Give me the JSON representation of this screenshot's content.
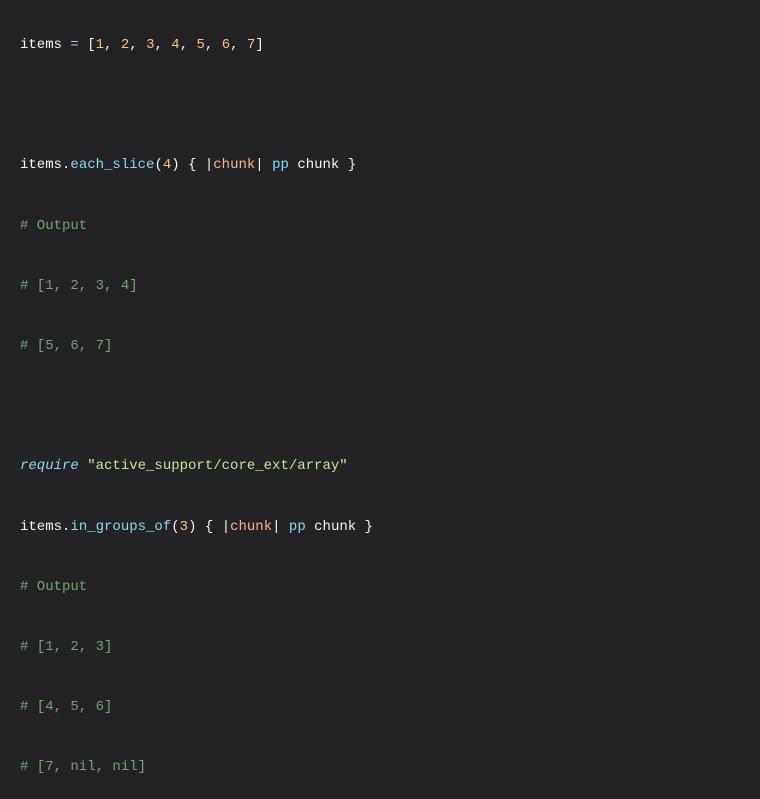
{
  "lines": {
    "l1": {
      "ident": "items",
      "op": "=",
      "open": "[",
      "n1": "1",
      "c1": ", ",
      "n2": "2",
      "c2": ", ",
      "n3": "3",
      "c3": ", ",
      "n4": "4",
      "c4": ", ",
      "n5": "5",
      "c5": ", ",
      "n6": "6",
      "c6": ", ",
      "n7": "7",
      "close": "]"
    },
    "l3": {
      "ident": "items",
      "dot1": ".",
      "method": "each_slice",
      "popen": "(",
      "arg": "4",
      "pclose": ")",
      "sp": " ",
      "bopen": "{ ",
      "pipe1": "|",
      "param": "chunk",
      "pipe2": "| ",
      "fn": "pp",
      "sp2": " ",
      "fnarg": "chunk",
      "bclose": " }"
    },
    "c_out1": "# Output",
    "c_arr1": "# [1, 2, 3, 4]",
    "c_arr2": "# [5, 6, 7]",
    "l8": {
      "keyword": "require",
      "sp": " ",
      "string": "\"active_support/core_ext/array\""
    },
    "l9": {
      "ident": "items",
      "dot1": ".",
      "method": "in_groups_of",
      "popen": "(",
      "arg": "3",
      "pclose": ")",
      "sp": " ",
      "bopen": "{ ",
      "pipe1": "|",
      "param": "chunk",
      "pipe2": "| ",
      "fn": "pp",
      "sp2": " ",
      "fnarg": "chunk",
      "bclose": " }"
    },
    "c_out2": "# Output",
    "c_arr3": "# [1, 2, 3]",
    "c_arr4": "# [4, 5, 6]",
    "c_arr5": "# [7, nil, nil]"
  }
}
